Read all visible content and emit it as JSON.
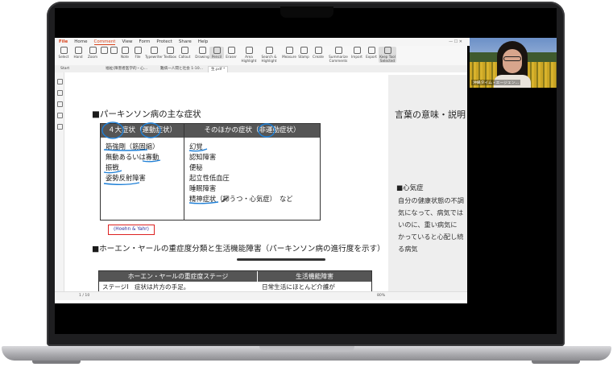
{
  "menubar": {
    "items": [
      "File",
      "Home",
      "Comment",
      "View",
      "Form",
      "Protect",
      "Share",
      "Help"
    ],
    "active": "Comment"
  },
  "ribbon": {
    "tools": [
      {
        "label": "Select",
        "icon": "select-icon"
      },
      {
        "label": "Hand",
        "icon": "hand-icon"
      },
      {
        "label": "Zoom",
        "icon": "zoom-icon"
      },
      {
        "label": "",
        "icon": "pen-icon"
      },
      {
        "label": "",
        "icon": "highlight-icon"
      },
      {
        "label": "Note",
        "icon": "note-icon"
      },
      {
        "label": "File",
        "icon": "file-icon"
      },
      {
        "label": "Typewriter",
        "icon": "typewriter-icon"
      },
      {
        "label": "Textbox",
        "icon": "textbox-icon"
      },
      {
        "label": "Callout",
        "icon": "callout-icon"
      },
      {
        "label": "Drawing",
        "icon": "drawing-icon"
      },
      {
        "label": "Pencil",
        "icon": "pencil-icon"
      },
      {
        "label": "Eraser",
        "icon": "eraser-icon"
      },
      {
        "label": "Area Highlight",
        "icon": "area-highlight-icon"
      },
      {
        "label": "Search & Highlight",
        "icon": "search-highlight-icon"
      },
      {
        "label": "Measure",
        "icon": "measure-icon"
      },
      {
        "label": "Stamp",
        "icon": "stamp-icon"
      },
      {
        "label": "Create",
        "icon": "create-icon"
      },
      {
        "label": "Summarize Comments",
        "icon": "summarize-icon"
      },
      {
        "label": "Import",
        "icon": "import-icon"
      },
      {
        "label": "Export",
        "icon": "export-icon"
      },
      {
        "label": "Keep Tool Selected",
        "icon": "keep-tool-icon"
      }
    ]
  },
  "tabs": {
    "items": [
      "Start",
      "福祉(障害者医学的・心...",
      "難病一人間と社会 1-10...",
      "生.pdf *"
    ]
  },
  "document": {
    "heading1": "■パーキンソン病の主な症状",
    "table1": {
      "col1_header": "４大症状（運動症状）",
      "col2_header": "そのほかの症状（非運動症状）",
      "col1_items": [
        "筋強剛（筋固縮）",
        "無動あるいは寡動",
        "振戦",
        "姿勢反射障害"
      ],
      "col2_items": [
        "幻覚",
        "認知障害",
        "便秘",
        "起立性低血圧",
        "睡眠障害",
        "精神症状（抑うつ・心気症）　など"
      ]
    },
    "annotation_box": "(Hoehn & Yahr)",
    "heading2": "■ホーエン・ヤールの重症度分類と生活機能障害（パーキンソン病の進行度を示す）",
    "table2": {
      "col1_header": "ホーエン・ヤールの重症度ステージ",
      "col2_header": "生活機能障害",
      "row1_col1": "ステージⅠ　症状は片方の手足。",
      "row1_col2": "日常生活にほとんど介護が"
    },
    "right_page": {
      "title": "言葉の意味・説明",
      "subheading": "■心気症",
      "lines": [
        "自分の健康状態の不調",
        "気になって、病気では",
        "いのに、重い病気に",
        "かっていると心配し続",
        "る病気"
      ]
    }
  },
  "statusbar": {
    "page_display": "1 / 10",
    "zoom": "80%"
  },
  "webcam": {
    "name_label": "沖縄タイム・エージェン..."
  }
}
